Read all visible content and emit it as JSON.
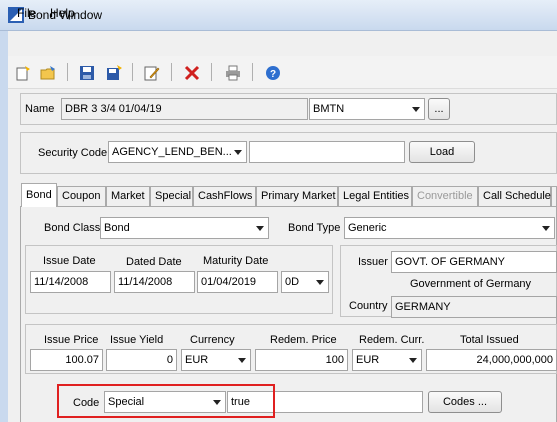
{
  "window": {
    "title": "Bond Window"
  },
  "menu": {
    "items": [
      "File",
      "Help"
    ]
  },
  "toolbar": {
    "icons": [
      "new-document-icon",
      "open-folder-icon",
      "save-icon",
      "save-all-icon",
      "edit-icon",
      "delete-icon",
      "print-icon",
      "help-icon"
    ]
  },
  "name_row": {
    "label": "Name",
    "value": "DBR 3 3/4 01/04/19",
    "type_value": "BMTN",
    "browse_label": "..."
  },
  "security": {
    "label": "Security Code",
    "code_type": "AGENCY_LEND_BEN...",
    "code_value": "",
    "load_label": "Load"
  },
  "tabs": [
    {
      "label": "Bond",
      "active": true,
      "disabled": false
    },
    {
      "label": "Coupon",
      "active": false,
      "disabled": false
    },
    {
      "label": "Market",
      "active": false,
      "disabled": false
    },
    {
      "label": "Special",
      "active": false,
      "disabled": false
    },
    {
      "label": "CashFlows",
      "active": false,
      "disabled": false
    },
    {
      "label": "Primary Market",
      "active": false,
      "disabled": false
    },
    {
      "label": "Legal Entities",
      "active": false,
      "disabled": false
    },
    {
      "label": "Convertible",
      "active": false,
      "disabled": true
    },
    {
      "label": "Call Schedule",
      "active": false,
      "disabled": false
    }
  ],
  "bond": {
    "class_label": "Bond Class",
    "class_value": "Bond",
    "type_label": "Bond Type",
    "type_value": "Generic"
  },
  "dates": {
    "issue_label": "Issue Date",
    "issue_value": "11/14/2008",
    "dated_label": "Dated Date",
    "dated_value": "11/14/2008",
    "maturity_label": "Maturity Date",
    "maturity_value": "01/04/2019",
    "period_value": "0D"
  },
  "issuer": {
    "label": "Issuer",
    "value": "GOVT. OF GERMANY",
    "full_name": "Government of Germany",
    "country_label": "Country",
    "country_value": "GERMANY"
  },
  "pricing": {
    "issue_price_label": "Issue Price",
    "issue_price_value": "100.07",
    "issue_yield_label": "Issue Yield",
    "issue_yield_value": "0",
    "currency_label": "Currency",
    "currency_value": "EUR",
    "redem_price_label": "Redem. Price",
    "redem_price_value": "100",
    "redem_curr_label": "Redem. Curr.",
    "redem_curr_value": "EUR",
    "total_issued_label": "Total Issued",
    "total_issued_value": "24,000,000,000"
  },
  "codes": {
    "label": "Code",
    "type_value": "Special",
    "value": "true",
    "button_label": "Codes ..."
  },
  "colors": {
    "highlight": "#e02020",
    "title_bg": "#c9d9ee"
  }
}
